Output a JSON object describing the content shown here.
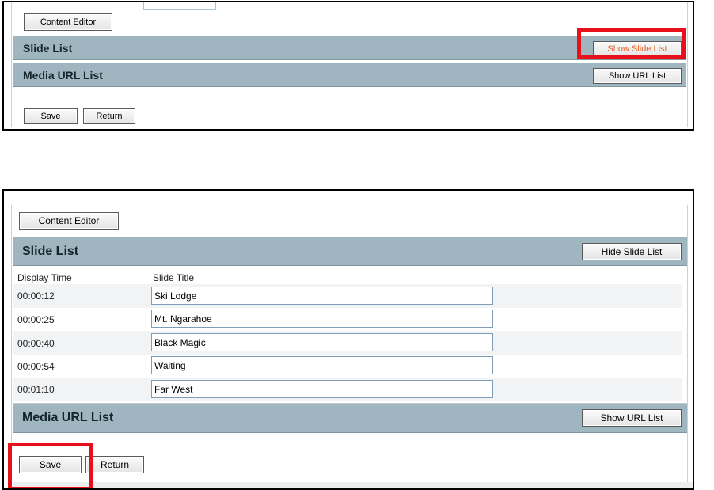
{
  "panel_collapsed": {
    "content_editor_label": "Content Editor",
    "slide_list_title": "Slide List",
    "show_slide_list_label": "Show Slide List",
    "media_url_title": "Media URL List",
    "show_url_list_label": "Show URL List",
    "save_label": "Save",
    "return_label": "Return"
  },
  "panel_expanded": {
    "content_editor_label": "Content Editor",
    "slide_list_title": "Slide List",
    "hide_slide_list_label": "Hide Slide List",
    "columns": {
      "display_time": "Display Time",
      "slide_title": "Slide Title"
    },
    "rows": [
      {
        "time": "00:00:12",
        "title": "Ski Lodge"
      },
      {
        "time": "00:00:25",
        "title": "Mt. Ngarahoe"
      },
      {
        "time": "00:00:40",
        "title": "Black Magic"
      },
      {
        "time": "00:00:54",
        "title": "Waiting"
      },
      {
        "time": "00:01:10",
        "title": "Far West"
      }
    ],
    "media_url_title": "Media URL List",
    "show_url_list_label": "Show URL List",
    "save_label": "Save",
    "return_label": "Return"
  },
  "colors": {
    "section_bar": "#9fb5bf",
    "highlight": "#e8101a",
    "show_slide_text": "#e8622a"
  }
}
